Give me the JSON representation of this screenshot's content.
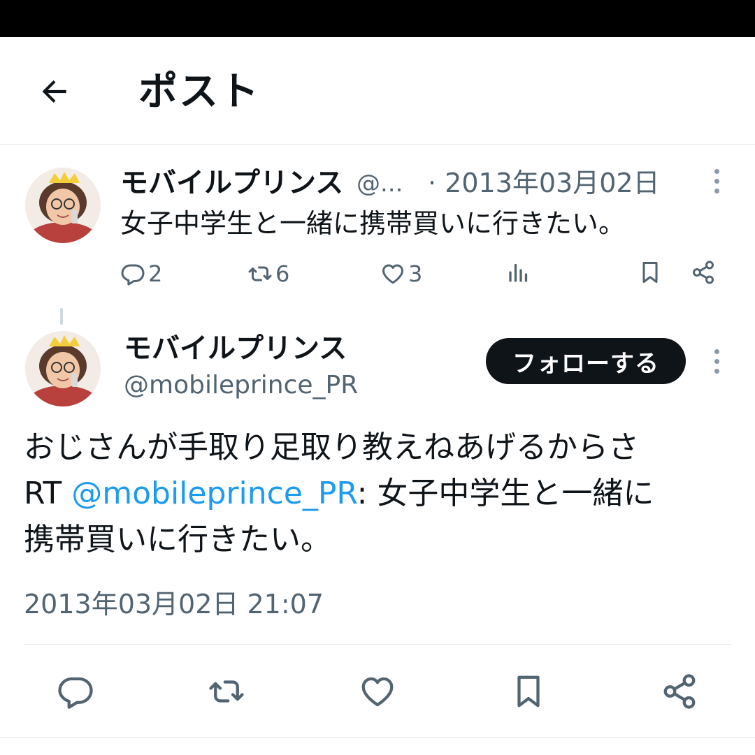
{
  "header": {
    "title": "ポスト"
  },
  "parent_post": {
    "display_name": "モバイルプリンス",
    "handle_truncated": "@...",
    "date": "· 2013年03月02日",
    "text": "女子中学生と一緒に携帯買いに行きたい。",
    "counts": {
      "replies": "2",
      "reposts": "6",
      "likes": "3"
    }
  },
  "main_post": {
    "display_name": "モバイルプリンス",
    "handle": "@mobileprince_PR",
    "follow_label": "フォローする",
    "text_line1": "おじさんが手取り足取り教えねあげるからさ",
    "text_rt": "RT ",
    "text_mention": "@mobileprince_PR",
    "text_line2_rest": ": 女子中学生と一緒に",
    "text_line3": "携帯買いに行きたい。",
    "timestamp": "2013年03月02日 21:07"
  },
  "icons": [
    "back-arrow-icon",
    "more-icon",
    "reply-icon",
    "repost-icon",
    "like-icon",
    "views-icon",
    "bookmark-icon",
    "share-icon"
  ],
  "colors": {
    "text": "#0f1419",
    "muted": "#536471",
    "link": "#1d9bf0",
    "follow_bg": "#0f1419"
  }
}
